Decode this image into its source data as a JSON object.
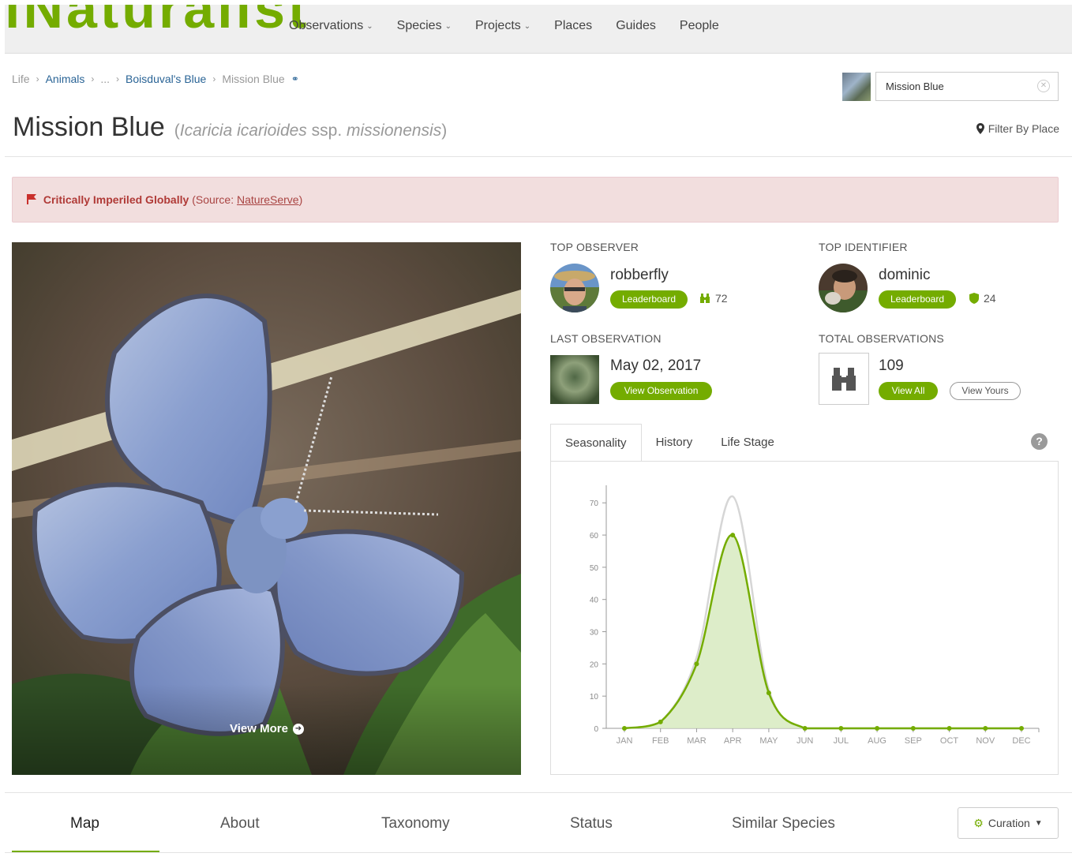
{
  "brand": {
    "accent": "#74ac00",
    "logo_fragment": "iNaturalist"
  },
  "nav": {
    "items": [
      {
        "label": "Observations",
        "dropdown": true
      },
      {
        "label": "Species",
        "dropdown": true
      },
      {
        "label": "Projects",
        "dropdown": true
      },
      {
        "label": "Places",
        "dropdown": false
      },
      {
        "label": "Guides",
        "dropdown": false
      },
      {
        "label": "People",
        "dropdown": false
      }
    ]
  },
  "breadcrumb": {
    "items": [
      "Life",
      "Animals",
      "...",
      "Boisduval's Blue",
      "Mission Blue"
    ]
  },
  "search": {
    "value": "Mission Blue"
  },
  "title": {
    "common_name": "Mission Blue",
    "sci_name": "Icaricia icarioides",
    "rank": "ssp.",
    "infra_name": "missionensis",
    "filter_label": "Filter By Place"
  },
  "alert": {
    "status": "Critically Imperiled Globally",
    "source_prefix": "(Source: ",
    "source": "NatureServe",
    "source_suffix": ")"
  },
  "photo": {
    "view_more": "View More"
  },
  "top_observer": {
    "heading": "TOP OBSERVER",
    "name": "robberfly",
    "leaderboard": "Leaderboard",
    "count": "72"
  },
  "top_identifier": {
    "heading": "TOP IDENTIFIER",
    "name": "dominic",
    "leaderboard": "Leaderboard",
    "count": "24"
  },
  "last_observation": {
    "heading": "LAST OBSERVATION",
    "date": "May 02, 2017",
    "button": "View Observation"
  },
  "total_observations": {
    "heading": "TOTAL OBSERVATIONS",
    "count": "109",
    "view_all": "View All",
    "view_yours": "View Yours"
  },
  "chart_tabs": [
    "Seasonality",
    "History",
    "Life Stage"
  ],
  "chart_data": {
    "type": "area",
    "categories": [
      "JAN",
      "FEB",
      "MAR",
      "APR",
      "MAY",
      "JUN",
      "JUL",
      "AUG",
      "SEP",
      "OCT",
      "NOV",
      "DEC"
    ],
    "series": [
      {
        "values": [
          0,
          2,
          20,
          60,
          11,
          0,
          0,
          0,
          0,
          0,
          0,
          0
        ],
        "color": "#74ac00"
      },
      {
        "values": [
          0,
          2,
          22,
          72,
          12,
          0,
          0,
          0,
          0,
          0,
          0,
          0
        ],
        "color": "#d6d6d6"
      }
    ],
    "yticks": [
      0,
      10,
      20,
      30,
      40,
      50,
      60,
      70
    ],
    "ylim": [
      0,
      73
    ],
    "grid": false
  },
  "bottom_tabs": [
    "Map",
    "About",
    "Taxonomy",
    "Status",
    "Similar Species"
  ],
  "curation": {
    "label": "Curation"
  }
}
